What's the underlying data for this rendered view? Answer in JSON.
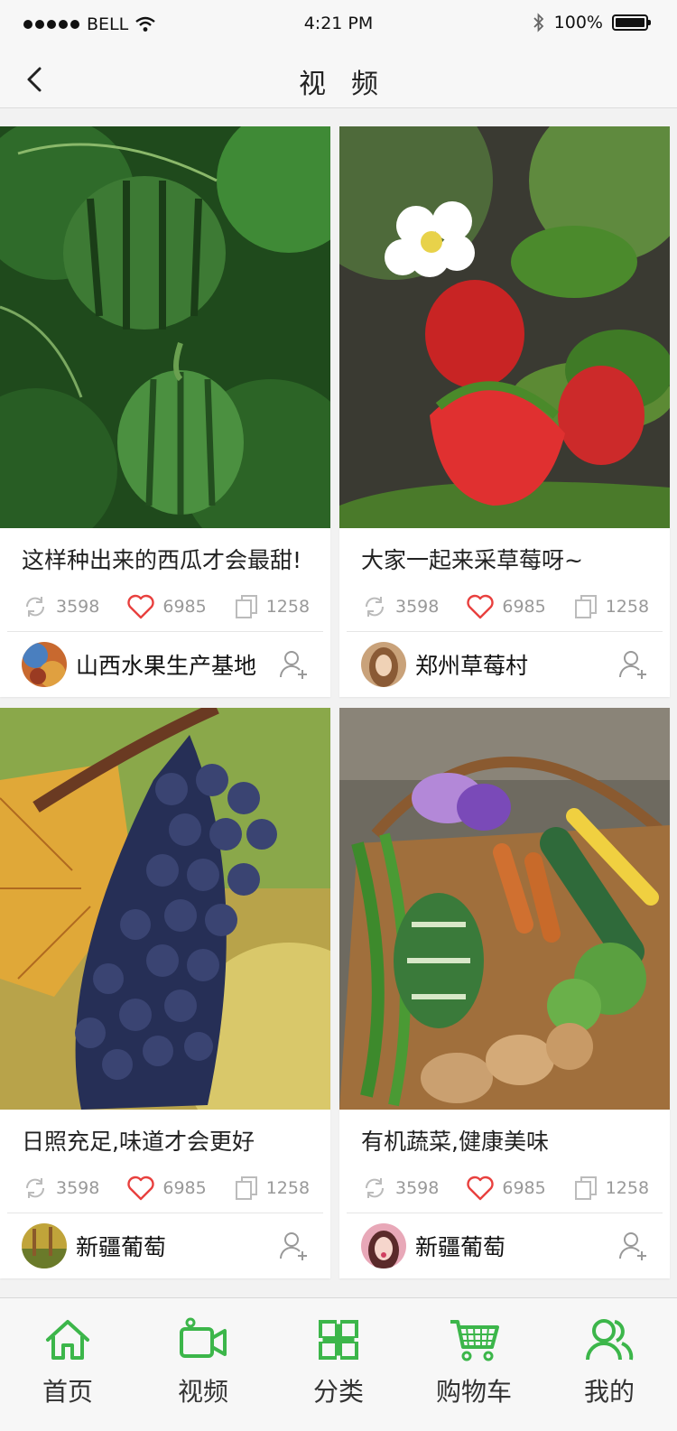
{
  "status_bar": {
    "carrier": "BELL",
    "time": "4:21 PM",
    "battery": "100%"
  },
  "nav": {
    "title": "视频"
  },
  "colors": {
    "accent": "#3cb64a",
    "like": "#e8403e",
    "muted": "#999999"
  },
  "cards": [
    {
      "title": "这样种出来的西瓜才会最甜!",
      "reposts": "3598",
      "likes": "6985",
      "copies": "1258",
      "author": "山西水果生产基地",
      "photo": "watermelon"
    },
    {
      "title": "大家一起来采草莓呀~",
      "reposts": "3598",
      "likes": "6985",
      "copies": "1258",
      "author": "郑州草莓村",
      "photo": "strawberry"
    },
    {
      "title": "日照充足,味道才会更好",
      "reposts": "3598",
      "likes": "6985",
      "copies": "1258",
      "author": "新疆葡萄",
      "photo": "grapes"
    },
    {
      "title": "有机蔬菜,健康美味",
      "reposts": "3598",
      "likes": "6985",
      "copies": "1258",
      "author": "新疆葡萄",
      "photo": "vegetable-basket"
    }
  ],
  "tabbar": {
    "items": [
      {
        "label": "首页",
        "icon": "home-icon"
      },
      {
        "label": "视频",
        "icon": "video-camera-icon"
      },
      {
        "label": "分类",
        "icon": "category-icon"
      },
      {
        "label": "购物车",
        "icon": "cart-icon"
      },
      {
        "label": "我的",
        "icon": "user-icon"
      }
    ]
  }
}
